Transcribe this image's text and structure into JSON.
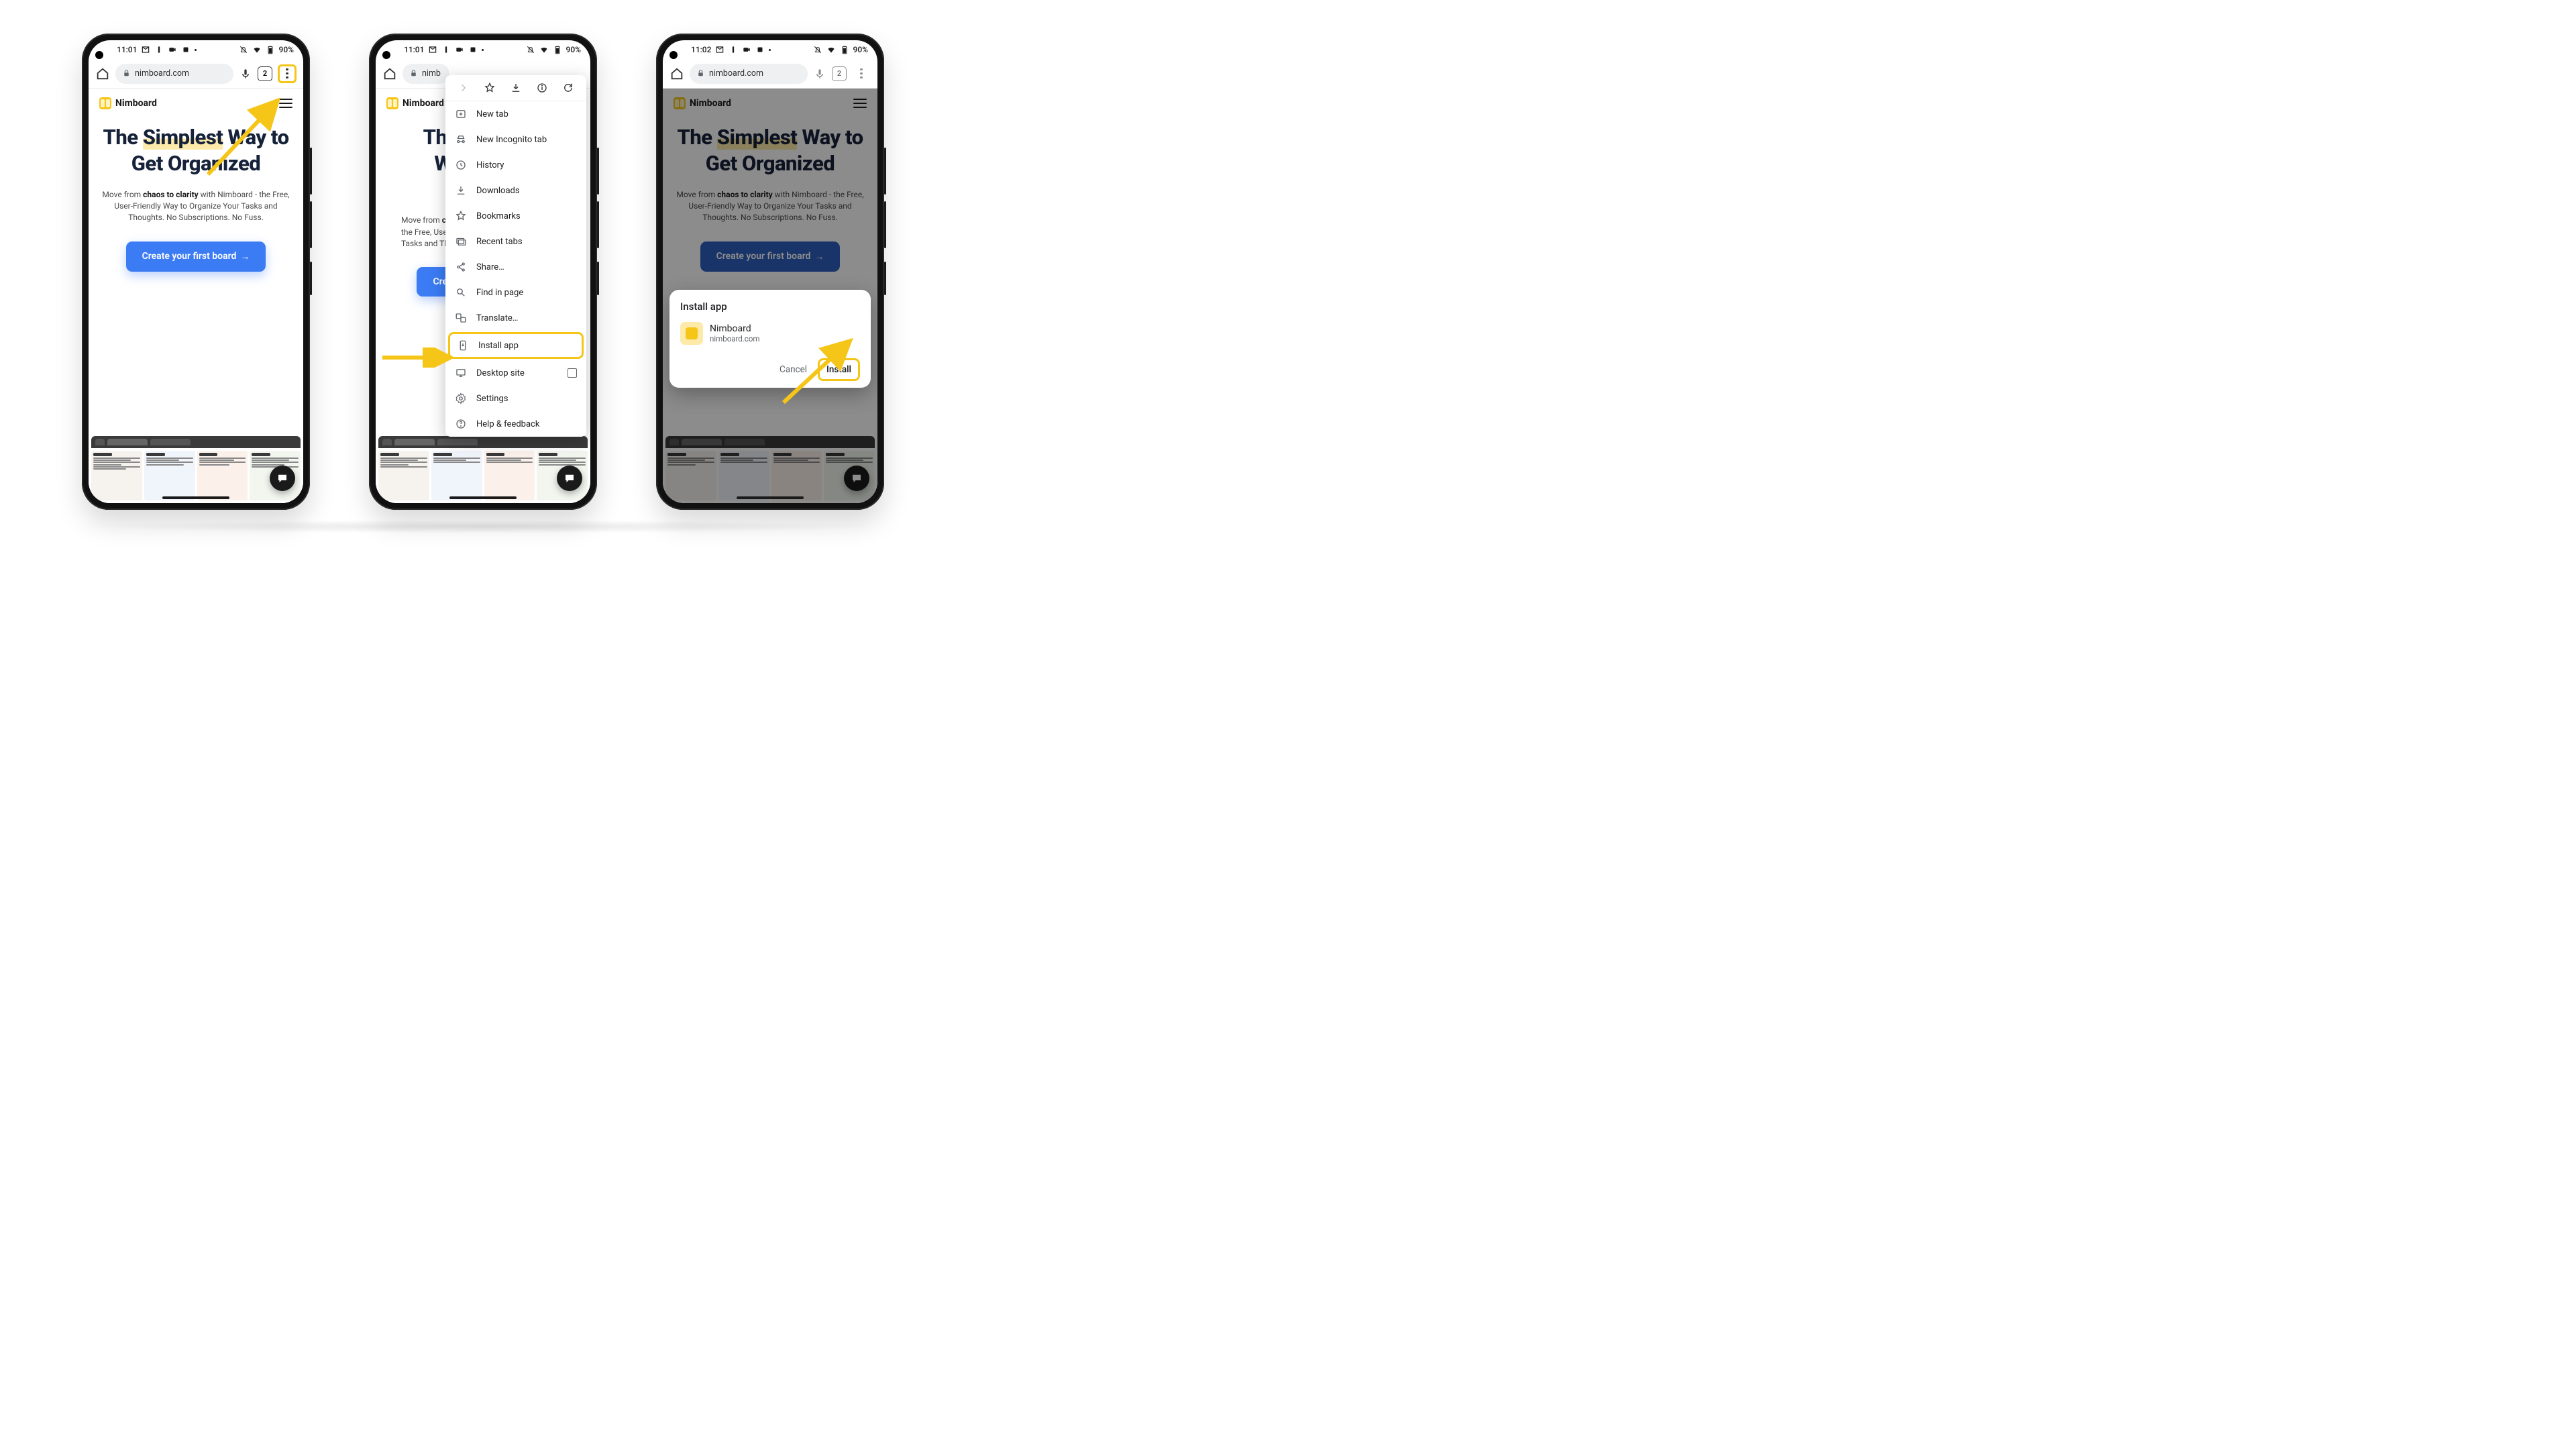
{
  "status": {
    "time1": "11:01",
    "time2": "11:02",
    "battery": "90%"
  },
  "browser": {
    "url": "nimboard.com",
    "tab_count": "2"
  },
  "site": {
    "brand": "Nimboard",
    "headline_pre": "The ",
    "headline_hl": "Simplest",
    "headline_post": " Way to Get Organized",
    "tag_pre": "Move from ",
    "tag_bold": "chaos to clarity",
    "tag_post": " with Nimboard - the Free, User-Friendly Way to Organize Your Tasks and Thoughts. No Subscriptions. No Fuss.",
    "cta": "Create your first board",
    "cta_arrow": "→"
  },
  "menu": {
    "new_tab": "New tab",
    "incognito": "New Incognito tab",
    "history": "History",
    "downloads": "Downloads",
    "bookmarks": "Bookmarks",
    "recent": "Recent tabs",
    "share": "Share…",
    "find": "Find in page",
    "translate": "Translate…",
    "install": "Install app",
    "desktop": "Desktop site",
    "settings": "Settings",
    "help": "Help & feedback"
  },
  "dialog": {
    "title": "Install app",
    "app_name": "Nimboard",
    "app_domain": "nimboard.com",
    "cancel": "Cancel",
    "install": "Install"
  }
}
